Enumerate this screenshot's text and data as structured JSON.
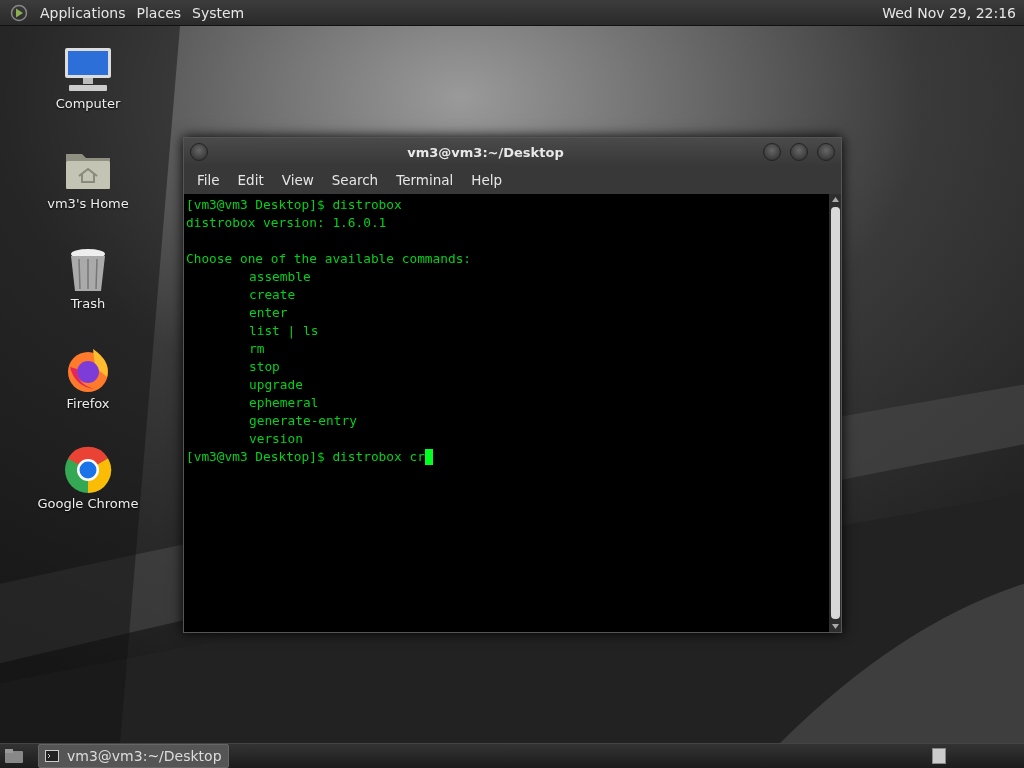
{
  "top_panel": {
    "menus": [
      "Applications",
      "Places",
      "System"
    ],
    "clock": "Wed Nov 29, 22:16"
  },
  "desktop_icons": [
    {
      "kind": "computer",
      "label": "Computer"
    },
    {
      "kind": "home",
      "label": "vm3's Home"
    },
    {
      "kind": "trash",
      "label": "Trash"
    },
    {
      "kind": "firefox",
      "label": "Firefox"
    },
    {
      "kind": "chrome",
      "label": "Google Chrome"
    }
  ],
  "terminal": {
    "title": "vm3@vm3:~/Desktop",
    "menu": [
      "File",
      "Edit",
      "View",
      "Search",
      "Terminal",
      "Help"
    ],
    "lines": [
      {
        "kind": "prompt",
        "prompt": "[vm3@vm3 Desktop]$",
        "text": "distrobox"
      },
      {
        "kind": "output",
        "text": "distrobox version: 1.6.0.1"
      },
      {
        "kind": "blank"
      },
      {
        "kind": "output",
        "text": "Choose one of the available commands:"
      },
      {
        "kind": "indented",
        "text": "assemble"
      },
      {
        "kind": "indented",
        "text": "create"
      },
      {
        "kind": "indented",
        "text": "enter"
      },
      {
        "kind": "indented",
        "text": "list | ls"
      },
      {
        "kind": "indented",
        "text": "rm"
      },
      {
        "kind": "indented",
        "text": "stop"
      },
      {
        "kind": "indented",
        "text": "upgrade"
      },
      {
        "kind": "indented",
        "text": "ephemeral"
      },
      {
        "kind": "indented",
        "text": "generate-entry"
      },
      {
        "kind": "indented",
        "text": "version"
      },
      {
        "kind": "prompt",
        "prompt": "[vm3@vm3 Desktop]$",
        "text": "distrobox cr",
        "cursor": true
      }
    ]
  },
  "taskbar": {
    "tasks": [
      {
        "label": "vm3@vm3:~/Desktop",
        "selected": true
      }
    ]
  }
}
